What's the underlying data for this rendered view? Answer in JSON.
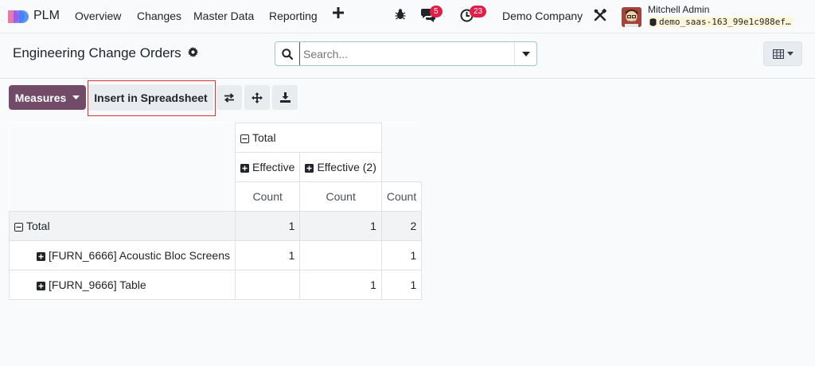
{
  "navbar": {
    "app_name": "PLM",
    "menu": [
      "Overview",
      "Changes",
      "Master Data",
      "Reporting"
    ],
    "chat_count": "5",
    "activity_count": "23",
    "company": "Demo Company",
    "user_name": "Mitchell Admin",
    "db_name": "demo_saas-163_99e1c988ef…"
  },
  "control_panel": {
    "title": "Engineering Change Orders",
    "search_placeholder": "Search..."
  },
  "toolbar": {
    "measures_label": "Measures",
    "insert_label": "Insert in Spreadsheet"
  },
  "pivot": {
    "col_total": "Total",
    "col_groups": [
      "Effective",
      "Effective (2)"
    ],
    "measure": "Count",
    "row_total": "Total",
    "rows": [
      {
        "label": "[FURN_6666] Acoustic Bloc Screens",
        "values": [
          "1",
          "",
          "1"
        ]
      },
      {
        "label": "[FURN_9666] Table",
        "values": [
          "",
          "1",
          "1"
        ]
      }
    ],
    "total_values": [
      "1",
      "1",
      "2"
    ]
  },
  "colors": {
    "primary": "#714b67",
    "badge": "#e11d48",
    "highlight": "#e03131"
  }
}
